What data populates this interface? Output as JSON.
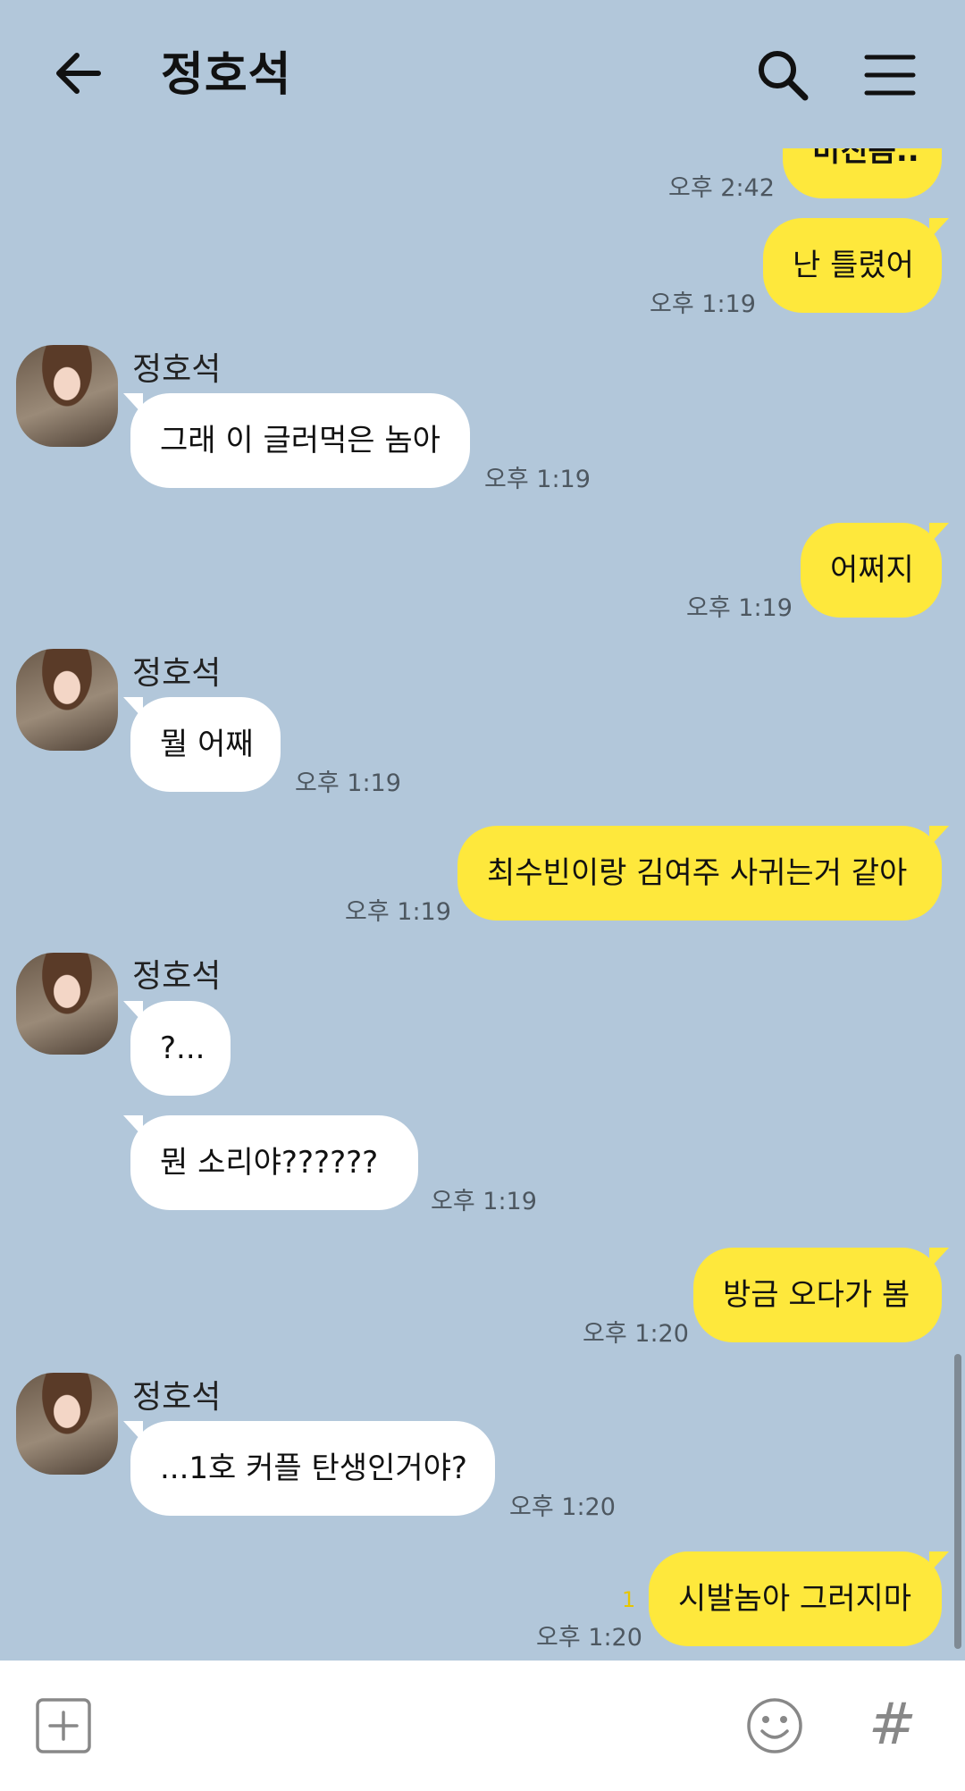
{
  "header": {
    "title": "정호석"
  },
  "messages": {
    "m0": {
      "text": "미친놈..",
      "time": "오후 2:42"
    },
    "m1": {
      "text": "난 틀렸어",
      "time": "오후 1:19"
    },
    "m2": {
      "sender": "정호석",
      "text": "그래 이 글러먹은 놈아",
      "time": "오후 1:19"
    },
    "m3": {
      "text": "어쩌지",
      "time": "오후 1:19"
    },
    "m4": {
      "sender": "정호석",
      "text": "뭘 어째",
      "time": "오후 1:19"
    },
    "m5": {
      "text": "최수빈이랑 김여주 사귀는거 같아",
      "time": "오후 1:19"
    },
    "m6": {
      "sender": "정호석",
      "text": "?..."
    },
    "m7": {
      "text": "뭔 소리야??????",
      "time": "오후 1:19"
    },
    "m8": {
      "text": "방금 오다가 봄",
      "time": "오후 1:20"
    },
    "m9": {
      "sender": "정호석",
      "text": "...1호 커플 탄생인거야?",
      "time": "오후 1:20"
    },
    "m10": {
      "text": "시발놈아 그러지마",
      "time": "오후 1:20",
      "unread": "1"
    }
  },
  "colors": {
    "background": "#b2c7da",
    "my_bubble": "#fee83c",
    "their_bubble": "#ffffff"
  },
  "icons": {
    "back": "arrow-left",
    "search": "magnifier",
    "menu": "hamburger",
    "add": "plus-square",
    "emoji": "smiley",
    "hash": "hash"
  }
}
